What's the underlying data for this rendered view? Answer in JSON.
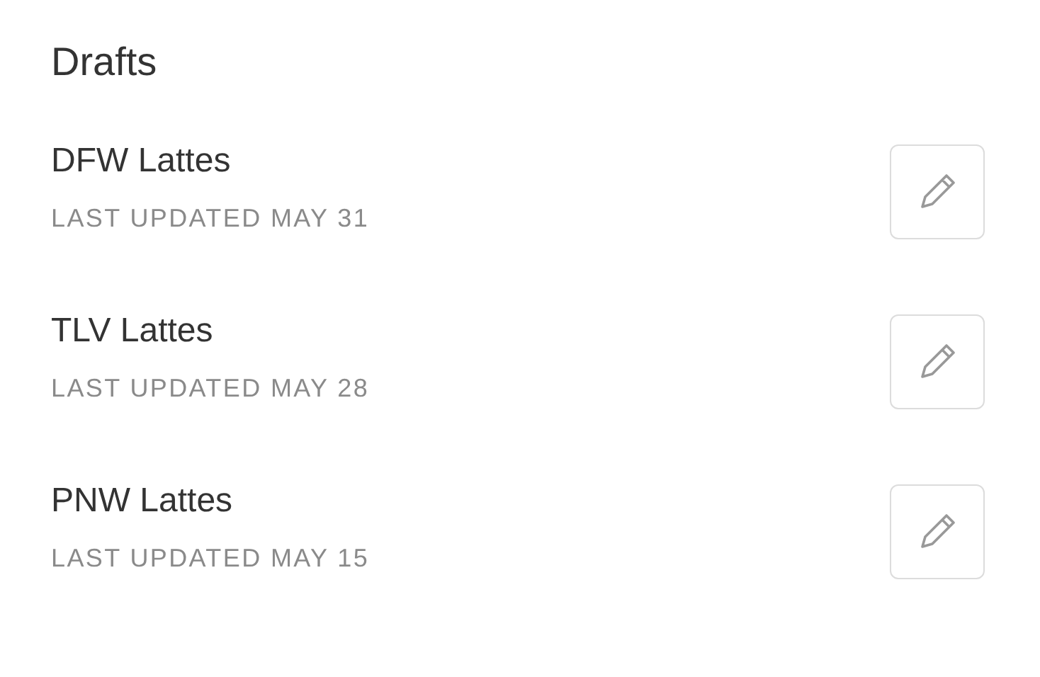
{
  "title": "Drafts",
  "drafts": [
    {
      "name": "DFW Lattes",
      "updated": "LAST UPDATED MAY 31"
    },
    {
      "name": "TLV Lattes",
      "updated": "LAST UPDATED MAY 28"
    },
    {
      "name": "PNW Lattes",
      "updated": "LAST UPDATED MAY 15"
    }
  ]
}
